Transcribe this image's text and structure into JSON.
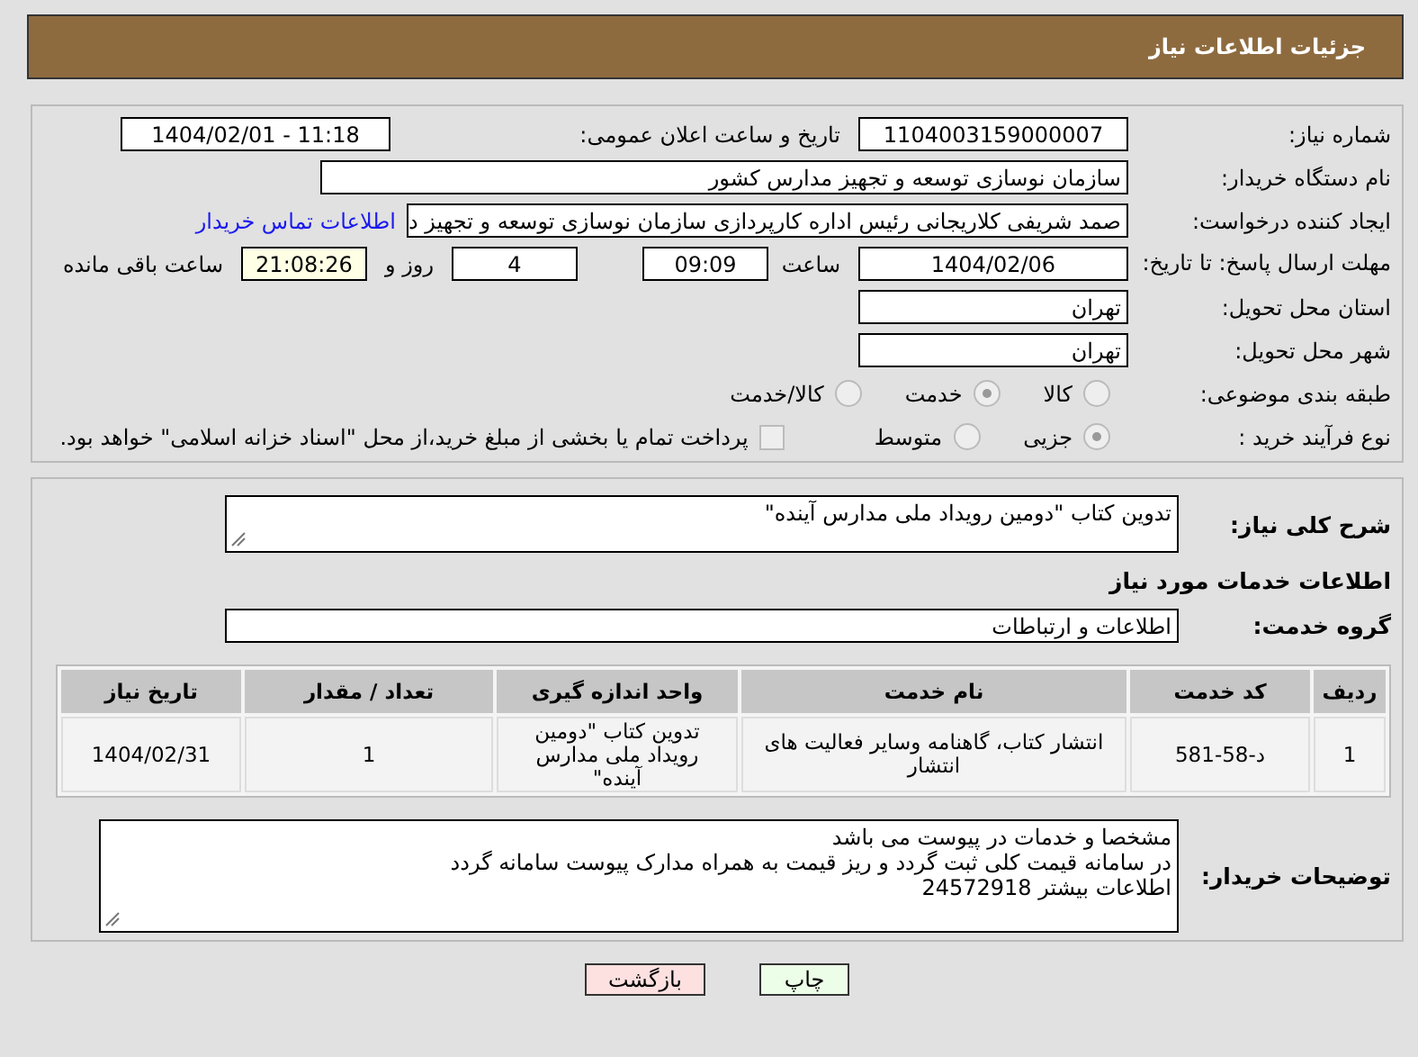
{
  "header": {
    "title": "جزئیات اطلاعات نیاز"
  },
  "need_number": {
    "label": "شماره نیاز:",
    "value": "1104003159000007"
  },
  "announce": {
    "label": "تاریخ و ساعت اعلان عمومی:",
    "value": "1404/02/01 - 11:18"
  },
  "buyer_org": {
    "label": "نام دستگاه خریدار:",
    "value": "سازمان نوسازی  توسعه و تجهیز مدارس کشور"
  },
  "requester": {
    "label": "ایجاد کننده درخواست:",
    "value": "صمد شریفی کلاریجانی رئیس اداره کارپردازی سازمان نوسازی  توسعه و تجهیز د",
    "link": "اطلاعات تماس خریدار"
  },
  "deadline": {
    "label": "مهلت ارسال پاسخ: تا تاریخ:",
    "date": "1404/02/06",
    "time_label": "ساعت",
    "time": "09:09",
    "days": "4",
    "days_label": "روز و",
    "remaining": "21:08:26",
    "remaining_label": "ساعت باقی مانده"
  },
  "province": {
    "label": "استان محل تحویل:",
    "value": "تهران"
  },
  "city": {
    "label": "شهر محل تحویل:",
    "value": "تهران"
  },
  "category": {
    "label": "طبقه بندی موضوعی:",
    "options": [
      {
        "label": "کالا",
        "selected": false
      },
      {
        "label": "خدمت",
        "selected": true
      },
      {
        "label": "کالا/خدمت",
        "selected": false
      }
    ]
  },
  "purchase_type": {
    "label": "نوع فرآیند خرید :",
    "options": [
      {
        "label": "جزیی",
        "selected": true
      },
      {
        "label": "متوسط",
        "selected": false
      }
    ],
    "payment": {
      "label": "پرداخت تمام یا بخشی از مبلغ خرید،از محل \"اسناد خزانه اسلامی\" خواهد بود.",
      "checked": false
    }
  },
  "description": {
    "label": "شرح کلی نیاز:",
    "value": "تدوین کتاب \"دومین رویداد ملی مدارس آینده\""
  },
  "services_title": "اطلاعات خدمات مورد نیاز",
  "service_group": {
    "label": "گروه خدمت:",
    "value": "اطلاعات و ارتباطات"
  },
  "table": {
    "columns": [
      "ردیف",
      "کد خدمت",
      "نام خدمت",
      "واحد اندازه گیری",
      "تعداد / مقدار",
      "تاریخ نیاز"
    ],
    "rows": [
      [
        "1",
        "د-58-581",
        "انتشار کتاب، گاهنامه وسایر فعالیت های انتشار",
        "تدوین کتاب \"دومین رویداد ملی مدارس آینده\"",
        "1",
        "1404/02/31"
      ]
    ]
  },
  "buyer_notes": {
    "label": "توضیحات خریدار:",
    "lines": [
      "مشخصا و خدمات در پیوست می باشد",
      "در سامانه قیمت کلی ثبت گردد و ریز قیمت به همراه مدارک پیوست سامانه گردد",
      "اطلاعات بیشتر 24572918"
    ]
  },
  "buttons": [
    {
      "label": "چاپ",
      "kind": "print"
    },
    {
      "label": "بازگشت",
      "kind": "back"
    }
  ]
}
